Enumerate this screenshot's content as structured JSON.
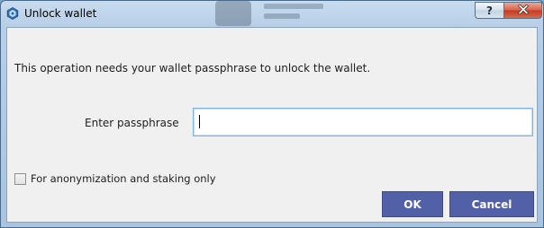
{
  "window": {
    "title": "Unlock wallet",
    "help_label": "?",
    "icon": "wallet-app-icon"
  },
  "dialog": {
    "message": "This operation needs your wallet passphrase to unlock the wallet.",
    "passphrase_label": "Enter passphrase",
    "passphrase_value": "",
    "checkbox_label": "For anonymization and staking only",
    "checkbox_checked": false,
    "ok_label": "OK",
    "cancel_label": "Cancel"
  },
  "colors": {
    "button_bg": "#5260a8",
    "input_focus_border": "#7eb4ea",
    "close_button": "#c43a1f"
  }
}
